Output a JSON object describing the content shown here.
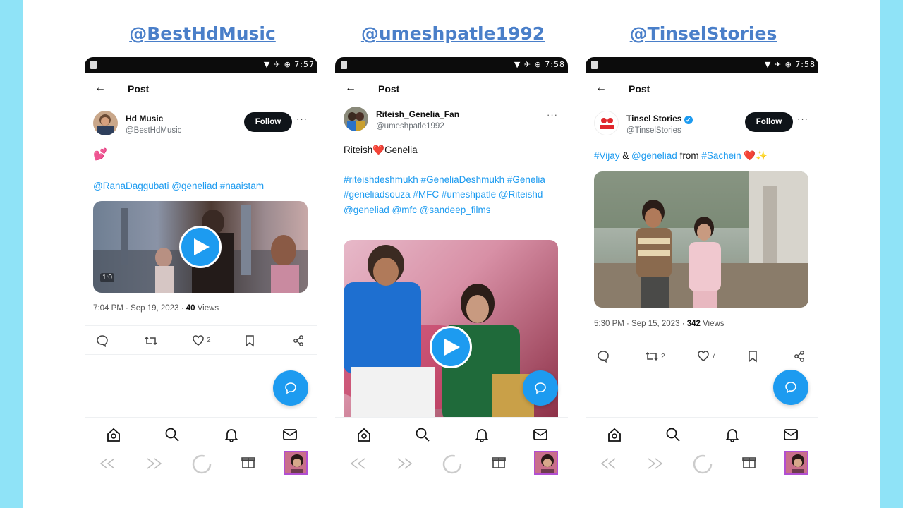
{
  "panels": [
    {
      "handle": "@BestHdMusic",
      "status_time": "7:57",
      "page_title": "Post",
      "author_name": "Hd Music",
      "author_handle": "@BestHdMusic",
      "follow_label": "Follow",
      "emoji": "💕",
      "text": "",
      "hashtags": "@RanaDaggubati @geneliad #naaistam",
      "video_duration": "1:0",
      "meta_time": "7:04 PM · Sep 19, 2023 · ",
      "views": "40",
      "views_label": " Views",
      "replies": "",
      "reposts": "",
      "likes": "2"
    },
    {
      "handle": "@umeshpatle1992",
      "status_time": "7:58",
      "page_title": "Post",
      "author_name": "Riteish_Genelia_Fan",
      "author_handle": "@umeshpatle1992",
      "text_a": "Riteish",
      "text_heart": "❤️",
      "text_b": "Genelia",
      "hashtags": "#riteishdeshmukh #GeneliaDeshmukh #Genelia #geneliadsouza #MFC #umeshpatle @Riteishd @geneliad @mfc @sandeep_films"
    },
    {
      "handle": "@TinselStories",
      "status_time": "7:58",
      "page_title": "Post",
      "author_name": "Tinsel Stories",
      "author_handle": "@TinselStories",
      "follow_label": "Follow",
      "tweet_h1": "#Vijay",
      "tweet_and": " & ",
      "tweet_h2": "@geneliad",
      "tweet_from": " from ",
      "tweet_h3": "#Sachein",
      "tweet_emoji": " ❤️✨",
      "meta_time": "5:30 PM · Sep 15, 2023 · ",
      "views": "342",
      "views_label": " Views",
      "reposts": "2",
      "likes": "7"
    }
  ],
  "colors": {
    "accent": "#1d9bf0",
    "handle": "#4a7fc9",
    "background": "#8fe3f7"
  },
  "icons": [
    "back-arrow-icon",
    "more-icon",
    "play-icon",
    "reply-icon",
    "repost-icon",
    "like-icon",
    "bookmark-icon",
    "share-icon",
    "compose-icon",
    "home-icon",
    "search-icon",
    "notifications-icon",
    "messages-icon",
    "rewind-icon",
    "forward-icon",
    "record-icon",
    "gift-icon"
  ]
}
